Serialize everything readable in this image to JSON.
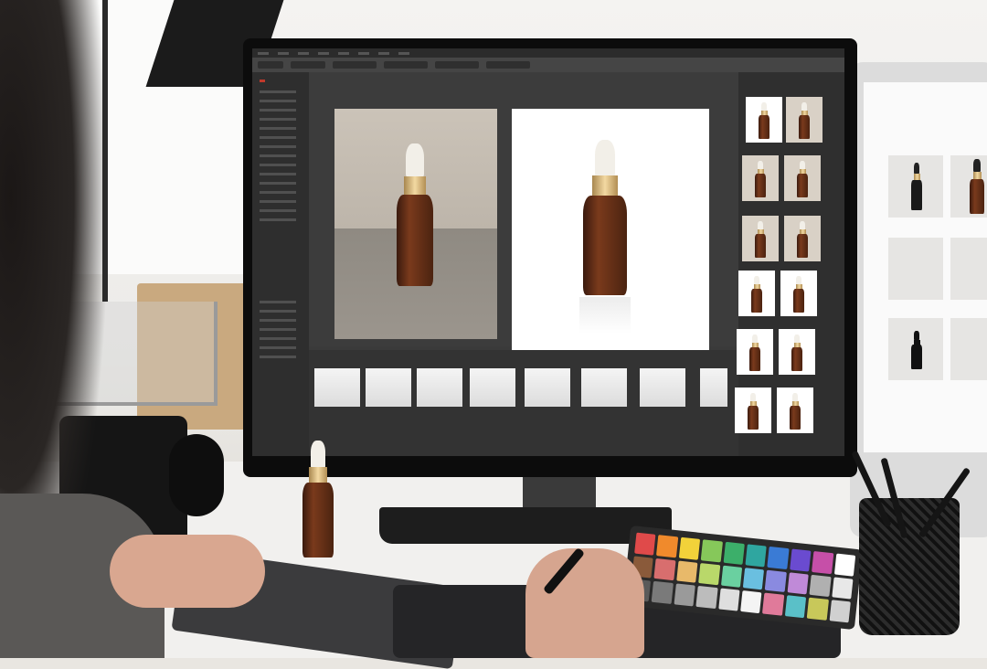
{
  "scene": {
    "description_free": true
  },
  "editor": {
    "menu_items": [
      "",
      "",
      "",
      "",
      "",
      "",
      "",
      "",
      "",
      ""
    ],
    "toolbar_fields": [
      "",
      "",
      "",
      "",
      "",
      "",
      ""
    ]
  },
  "colors": {
    "editor_bg": "#3a3a3a",
    "bottle_amber": "#5a2a12",
    "gold_collar": "#d4b06e",
    "dropper_bulb": "#f2efe8"
  },
  "checker_swatches": [
    "#e04a4a",
    "#f08a2c",
    "#f2d23a",
    "#86c85a",
    "#3caf6a",
    "#2fa6a0",
    "#3a7bd5",
    "#6a4bd0",
    "#c64fa8",
    "#ffffff",
    "#8a5a3a",
    "#d86e6e",
    "#e8b96a",
    "#b9d86a",
    "#6ad0a0",
    "#6abfe0",
    "#8a8ae0",
    "#c08ad8",
    "#b0b0b0",
    "#e8e8e8",
    "#5a5a5a",
    "#7a7a7a",
    "#9a9a9a",
    "#bcbcbc",
    "#dedede",
    "#f4f4f4",
    "#e07a9a",
    "#5ac0c8",
    "#c8c85a",
    "#d0d0d0"
  ]
}
